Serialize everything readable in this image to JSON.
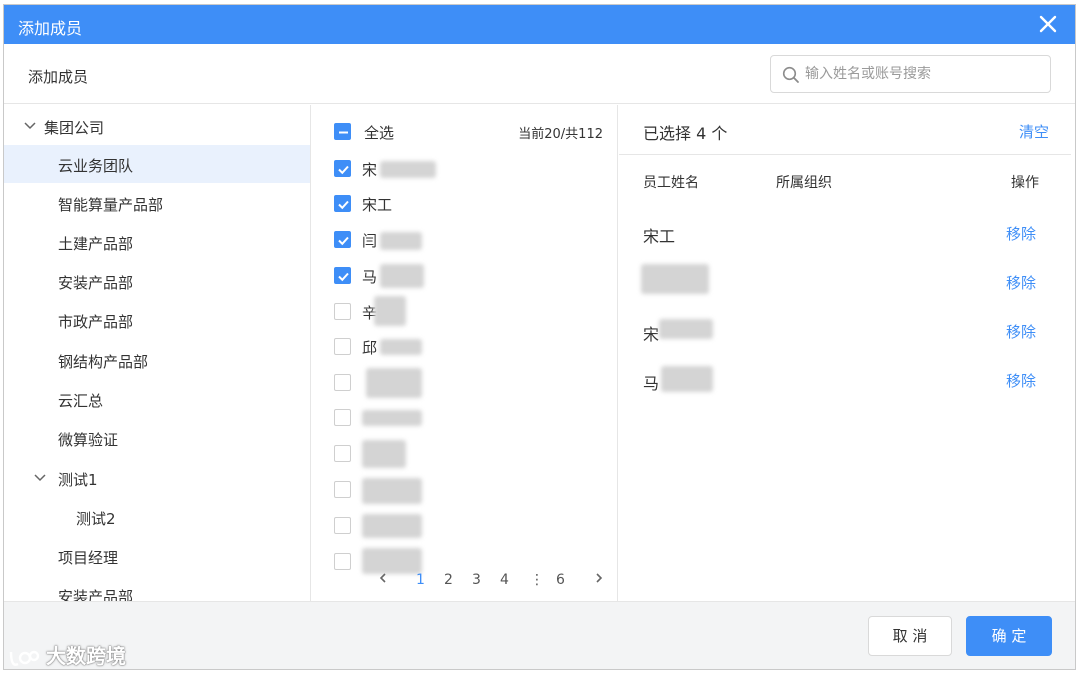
{
  "dialog": {
    "title": "添加成员",
    "subtitle": "添加成员",
    "search_placeholder": "输入姓名或账号搜索",
    "accent_color": "#3e8ef7"
  },
  "tree": {
    "items": [
      {
        "label": "集团公司",
        "expanded": true
      },
      {
        "label": "云业务团队",
        "selected": true
      },
      {
        "label": "智能算量产品部"
      },
      {
        "label": "土建产品部"
      },
      {
        "label": "安装产品部"
      },
      {
        "label": "市政产品部"
      },
      {
        "label": "钢结构产品部"
      },
      {
        "label": "云汇总"
      },
      {
        "label": "微算验证"
      },
      {
        "label": "测试1",
        "expanded": true
      },
      {
        "label": "测试2"
      },
      {
        "label": "项目经理"
      },
      {
        "label": "安装产品部"
      }
    ]
  },
  "members": {
    "select_all_label": "全选",
    "count_label": "当前20/共112",
    "rows": [
      {
        "name": "宋",
        "checked": true
      },
      {
        "name": "宋工",
        "checked": true
      },
      {
        "name": "闫",
        "checked": true
      },
      {
        "name": "马",
        "checked": true
      },
      {
        "name": "辛",
        "checked": false
      },
      {
        "name": "邱",
        "checked": false
      },
      {
        "name": "",
        "checked": false
      },
      {
        "name": "",
        "checked": false
      },
      {
        "name": "",
        "checked": false
      },
      {
        "name": "",
        "checked": false
      },
      {
        "name": "",
        "checked": false
      },
      {
        "name": "",
        "checked": false
      }
    ],
    "pagination": {
      "prev_icon": "chevron-left-icon",
      "pages": [
        "1",
        "2",
        "3",
        "4",
        "⋮",
        "6"
      ],
      "current": "1",
      "next_icon": "chevron-right-icon"
    }
  },
  "selected": {
    "count_label": "已选择 4 个",
    "clear_label": "清空",
    "headers": {
      "name": "员工姓名",
      "org": "所属组织",
      "action": "操作"
    },
    "rows": [
      {
        "name": "宋工",
        "action": "移除"
      },
      {
        "name": "",
        "action": "移除"
      },
      {
        "name": "宋",
        "action": "移除"
      },
      {
        "name": "马",
        "action": "移除"
      }
    ]
  },
  "footer": {
    "cancel_label": "取 消",
    "ok_label": "确 定"
  },
  "watermark": {
    "text": "大数跨境"
  }
}
